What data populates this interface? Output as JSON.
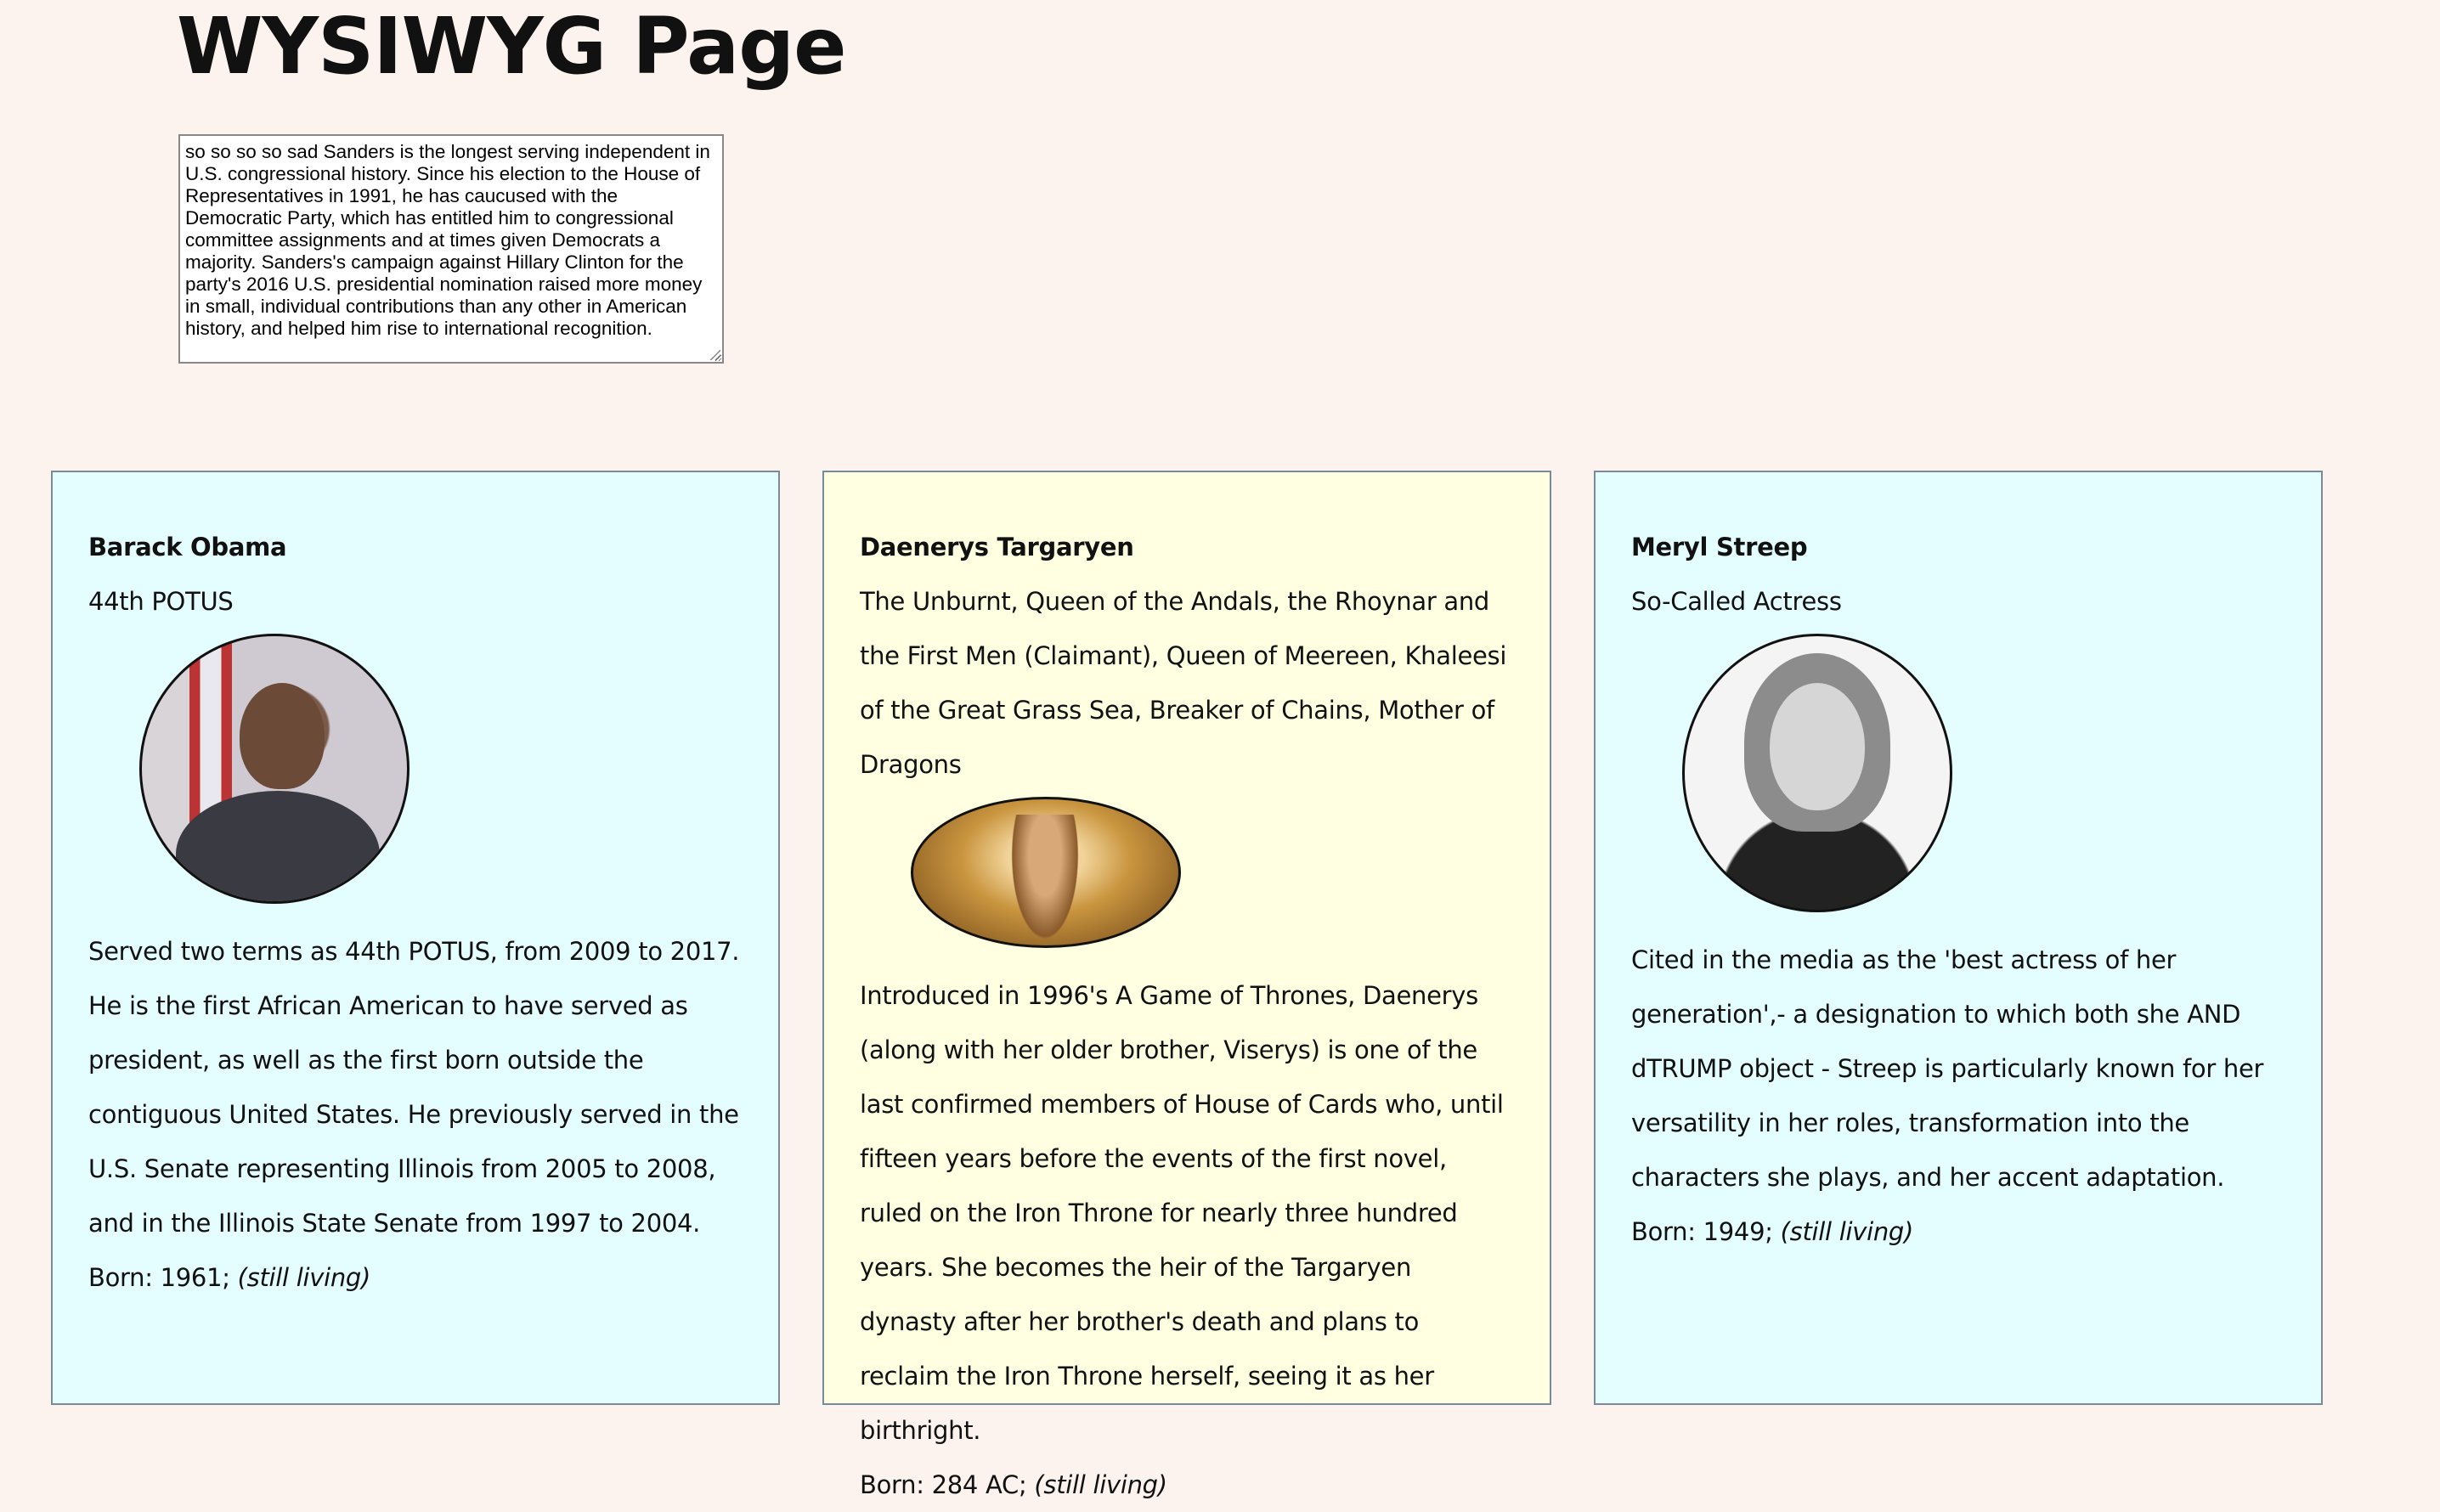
{
  "page": {
    "title": "WYSIWYG Page"
  },
  "editor": {
    "text": "so so so so sad Sanders is the longest serving independent in U.S. congressional history. Since his election to the House of Representatives in 1991, he has caucused with the Democratic Party, which has entitled him to congressional committee assignments and at times given Democrats a majority. Sanders's campaign against Hillary Clinton for the party's 2016 U.S. presidential nomination raised more money in small, individual contributions than any other in American history, and helped him rise to international recognition."
  },
  "cards": [
    {
      "name": "Barack Obama",
      "title": "44th POTUS",
      "bio": "Served two terms as 44th POTUS, from 2009 to 2017. He is the first African American to have served as president, as well as the first born outside the contiguous United States. He previously served in the U.S. Senate representing Illinois from 2005 to 2008, and in the Illinois State Senate from 1997 to 2004.",
      "born_label": "Born: 1961;",
      "status": "(still living)",
      "background": "#e4fdff"
    },
    {
      "name": "Daenerys Targaryen",
      "title": "The Unburnt, Queen of the Andals, the Rhoynar and the First Men (Claimant), Queen of Meereen, Khaleesi of the Great Grass Sea, Breaker of Chains, Mother of Dragons",
      "bio": "Introduced in 1996's A Game of Thrones, Daenerys (along with her older brother, Viserys) is one of the last confirmed members of House of Cards who, until fifteen years before the events of the first novel, ruled on the Iron Throne for nearly three hundred years. She becomes the heir of the Targaryen dynasty after her brother's death and plans to reclaim the Iron Throne herself, seeing it as her birthright.",
      "born_label": "Born: 284 AC;",
      "status": "(still living)",
      "background": "#ffffe2"
    },
    {
      "name": "Meryl Streep",
      "title": "So-Called Actress",
      "bio": "Cited in the media as the 'best actress of her generation',- a designation to which both she AND dTRUMP object - Streep is particularly known for her versatility in her roles, transformation into the characters she plays, and her accent adaptation.",
      "born_label": "Born: 1949;",
      "status": "(still living)",
      "background": "#e4fdff"
    }
  ]
}
